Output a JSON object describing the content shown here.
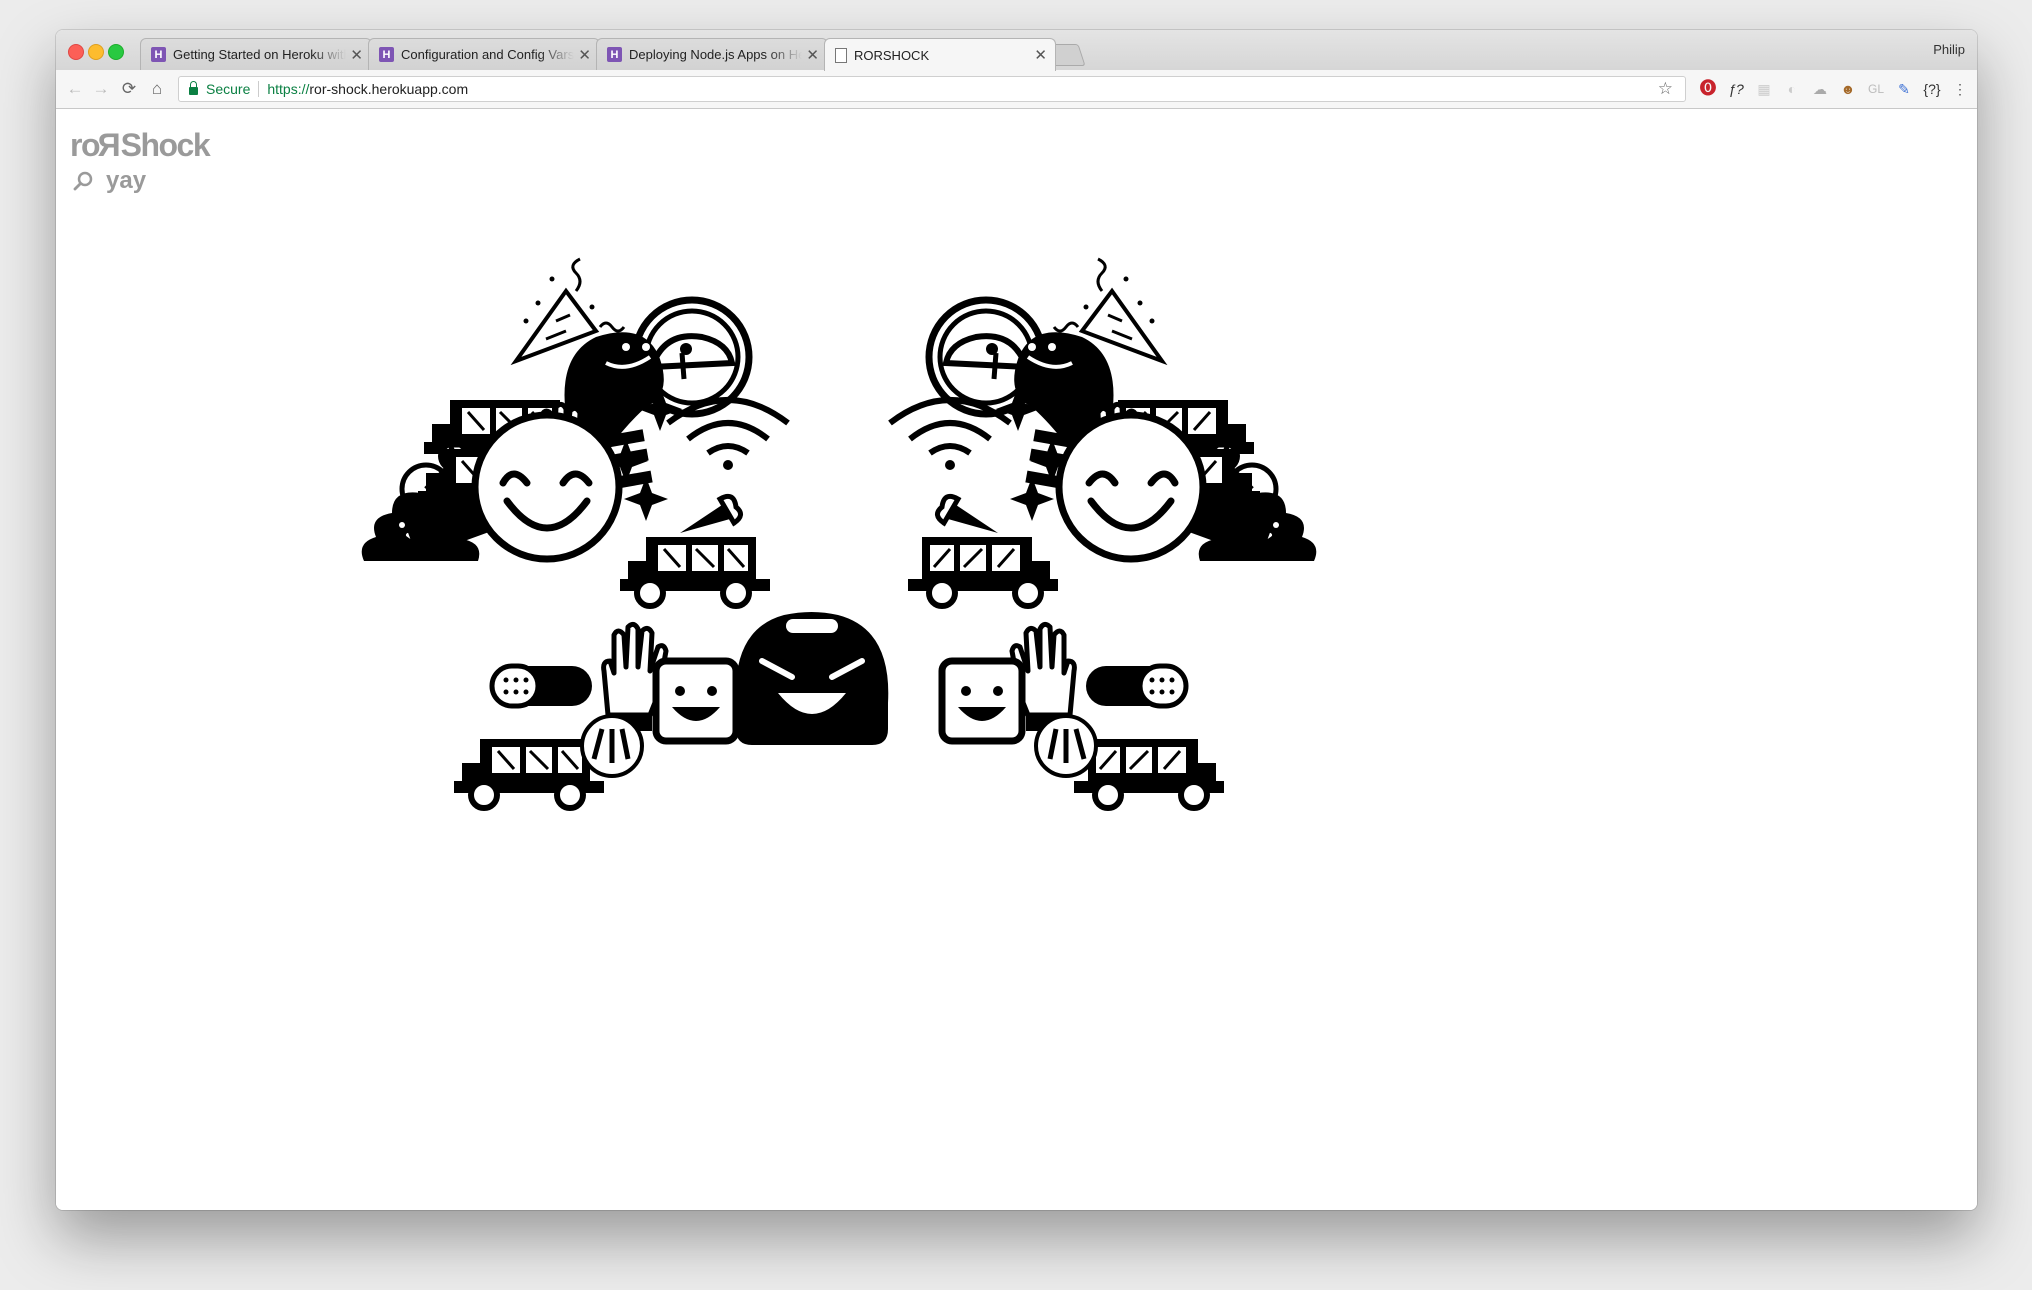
{
  "browser": {
    "tabs": [
      {
        "title": "Getting Started on Heroku with",
        "icon": "heroku-icon"
      },
      {
        "title": "Configuration and Config Vars",
        "icon": "heroku-icon"
      },
      {
        "title": "Deploying Node.js Apps on Her",
        "icon": "heroku-icon"
      },
      {
        "title": "RORSHOCK",
        "icon": "document-icon",
        "active": true
      }
    ],
    "profile_name": "Philip",
    "secure_label": "Secure",
    "url_scheme": "https://",
    "url_host": "ror-shock.herokuapp.com",
    "extensions": [
      "pinterest-icon",
      "fontface-icon",
      "grid-icon",
      "pixel-icon",
      "cloud-icon",
      "avatar-icon",
      "gl-icon",
      "pen-icon",
      "json-icon",
      "menu-icon"
    ],
    "extension_text": {
      "fontface": "ƒ?",
      "gl": "GL",
      "json": "{?}"
    }
  },
  "page": {
    "logo": {
      "part1": "ro",
      "flipped": "R",
      "part2": "Shock"
    },
    "query": "yay",
    "icons_left": [
      "party-popper-icon",
      "ghost-icon",
      "ufo-icon",
      "wifi-icon",
      "food-truck-icon",
      "bicycle-icon",
      "high-five-icon",
      "sparkles-icon",
      "hammer-icon",
      "poop-icon",
      "smiley-icon",
      "ice-cream-truck-icon",
      "band-aid-icon",
      "clapping-icon",
      "happy-box-icon",
      "devil-icon"
    ],
    "colors": {
      "ink": "#000000",
      "logo": "#9a9a9a"
    }
  }
}
